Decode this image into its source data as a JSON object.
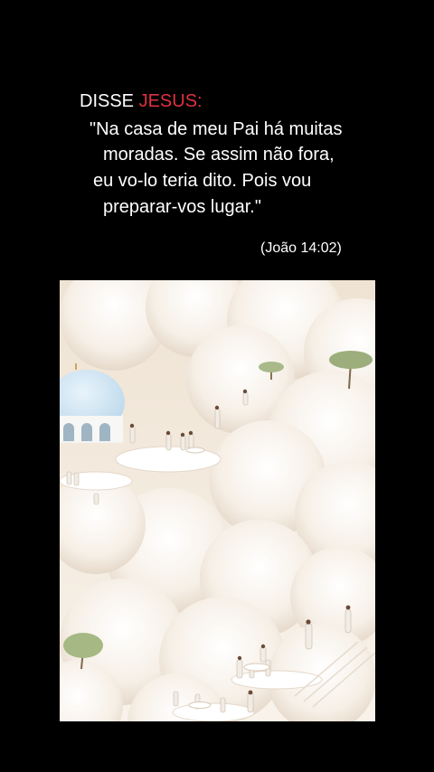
{
  "header": {
    "speaker_prefix": "DISSE ",
    "speaker_name": "JESUS:",
    "speaker_name_color": "#e0313f",
    "quote_lines": [
      "\"Na casa de meu Pai há muitas",
      "moradas. Se assim não fora,",
      "eu vo-lo teria dito. Pois vou",
      "preparar-vos lugar.\""
    ],
    "reference": "(João 14:02)"
  },
  "scene": {
    "description_icon": "heavenly-clouds-illustration",
    "palette": {
      "sky": "#f4ece1",
      "cloud": "#ffffff",
      "shadow": "#e9dccd",
      "dome": "#cfe6f5"
    }
  }
}
